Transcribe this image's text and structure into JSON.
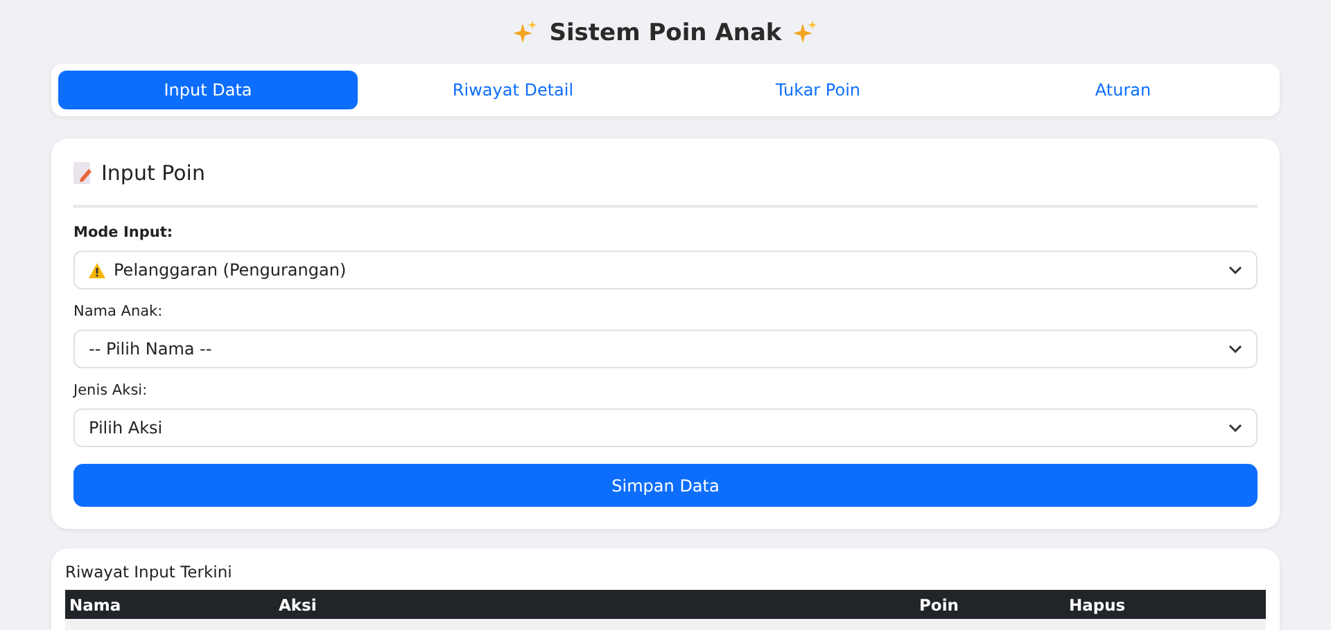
{
  "title": "Sistem Poin Anak",
  "tabs": [
    {
      "label": "Input Data",
      "selected": true
    },
    {
      "label": "Riwayat Detail",
      "selected": false
    },
    {
      "label": "Tukar Poin",
      "selected": false
    },
    {
      "label": "Aturan",
      "selected": false
    }
  ],
  "form": {
    "heading": "Input Poin",
    "fields": [
      {
        "label": "Mode Input:",
        "strong": true,
        "kind": "warning",
        "value": "Pelanggaran (Pengurangan)"
      },
      {
        "label": "Nama Anak:",
        "strong": false,
        "kind": "plain",
        "value": "-- Pilih Nama --"
      },
      {
        "label": "Jenis Aksi:",
        "strong": false,
        "kind": "plain",
        "value": "Pilih Aksi"
      }
    ],
    "submit": "Simpan Data"
  },
  "history": {
    "title": "Riwayat Input Terkini",
    "columns": [
      "Nama",
      "Aksi",
      "Poin",
      "Hapus"
    ]
  }
}
